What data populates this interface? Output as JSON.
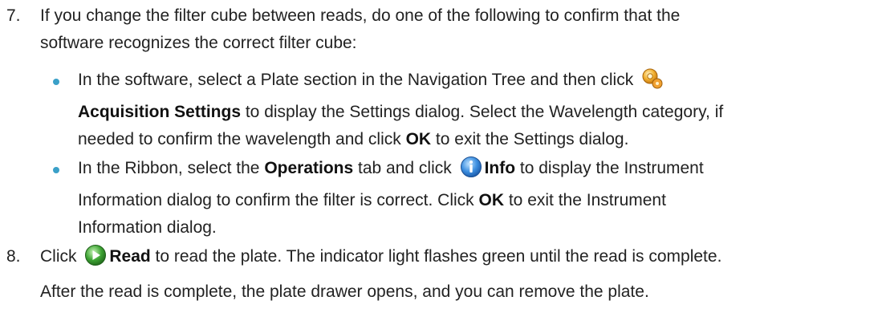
{
  "step7": {
    "number": "7.",
    "line1": "If you change the filter cube between reads, do one of the following to confirm that the",
    "line2": "software recognizes the correct filter cube:",
    "bullet1": {
      "l1_before": "In the software, select a Plate section in the Navigation Tree and then click",
      "l2_bold": "Acquisition Settings",
      "l2_after": " to display the Settings dialog. Select the Wavelength category, if",
      "l3_before": "needed to confirm the wavelength and click ",
      "l3_bold": "OK",
      "l3_after": " to exit the Settings dialog.",
      "icon": "acquisition-settings-icon"
    },
    "bullet2": {
      "l1_before": "In the Ribbon, select the ",
      "l1_bold1": "Operations",
      "l1_mid": " tab and click ",
      "l1_bold2": "Info",
      "l1_after": " to display the Instrument",
      "l2_before": "Information dialog to confirm the filter is correct. Click ",
      "l2_bold": "OK",
      "l2_after": " to exit the Instrument",
      "l3": "Information dialog.",
      "icon": "info-icon"
    }
  },
  "step8": {
    "number": "8.",
    "l1_before": "Click ",
    "l1_bold": "Read",
    "l1_after": " to read the plate. The indicator light flashes green until the read is complete.",
    "l2": "After the read is complete, the plate drawer opens, and you can remove the plate.",
    "icon": "read-play-icon"
  },
  "colors": {
    "bullet": "#3aa0c8",
    "text": "#222222",
    "info_blue": "#2b7fd1",
    "read_green": "#3fa535",
    "settings_orange": "#e8961e"
  }
}
